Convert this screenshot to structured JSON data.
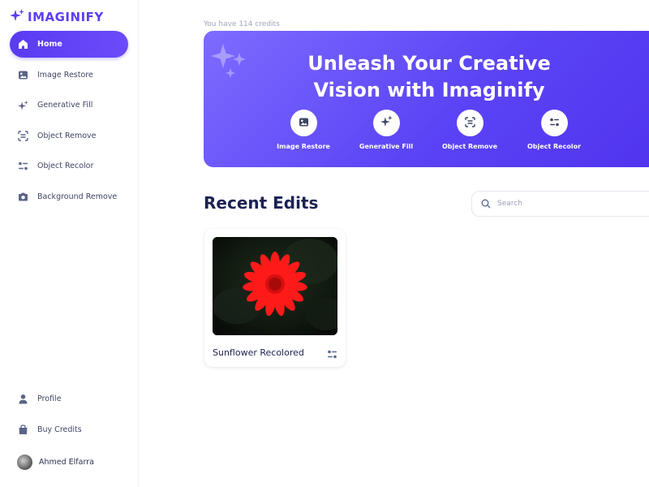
{
  "app": {
    "name": "IMAGINIFY"
  },
  "sidebar": {
    "items": [
      {
        "label": "Home",
        "icon": "home-icon",
        "active": true
      },
      {
        "label": "Image Restore",
        "icon": "image-icon"
      },
      {
        "label": "Generative Fill",
        "icon": "sparkles-icon"
      },
      {
        "label": "Object Remove",
        "icon": "scan-icon"
      },
      {
        "label": "Object Recolor",
        "icon": "filter-icon"
      },
      {
        "label": "Background Remove",
        "icon": "camera-icon"
      }
    ],
    "bottom": [
      {
        "label": "Profile",
        "icon": "user-icon"
      },
      {
        "label": "Buy Credits",
        "icon": "bag-icon"
      }
    ],
    "user": {
      "name": "Ahmed Elfarra"
    }
  },
  "main": {
    "credits": "You have 114 credits",
    "banner": {
      "title_line1": "Unleash Your Creative",
      "title_line2": "Vision with Imaginify",
      "tools": [
        {
          "label": "Image Restore",
          "icon": "image-icon"
        },
        {
          "label": "Generative Fill",
          "icon": "sparkles-icon"
        },
        {
          "label": "Object Remove",
          "icon": "scan-icon"
        },
        {
          "label": "Object Recolor",
          "icon": "filter-icon"
        }
      ]
    },
    "recent": {
      "title": "Recent Edits",
      "search_placeholder": "Search",
      "cards": [
        {
          "title": "Sunflower Recolored",
          "icon": "filter-icon"
        }
      ]
    }
  },
  "colors": {
    "accent": "#5b3ff5",
    "heading": "#1b2253",
    "flower": "#ff1a1a"
  }
}
